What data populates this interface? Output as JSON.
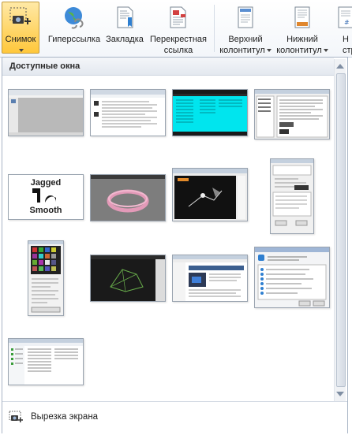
{
  "ribbon": {
    "buttons": [
      {
        "id": "snimok",
        "label": "Снимок",
        "dropdown": true,
        "icon": "screenshot-icon"
      },
      {
        "id": "hyperlink",
        "label": "Гиперссылка",
        "icon": "globe-link-icon"
      },
      {
        "id": "bookmark",
        "label": "Закладка",
        "icon": "bookmark-icon"
      },
      {
        "id": "cross",
        "label_1": "Перекрестная",
        "label_2": "ссылка",
        "icon": "cross-reference-icon"
      },
      {
        "id": "header",
        "label_1": "Верхний",
        "label_2": "колонтитул",
        "dropdown": true,
        "icon": "header-icon"
      },
      {
        "id": "footer",
        "label_1": "Нижний",
        "label_2": "колонтитул",
        "dropdown": true,
        "icon": "footer-icon"
      },
      {
        "id": "pagenum",
        "label_1": "Н",
        "label_2": "стра",
        "icon": "page-number-icon"
      }
    ]
  },
  "panel": {
    "header": "Доступные окна",
    "thumbnails": [
      {
        "name": "window-thumb-1",
        "kind": "gray-app"
      },
      {
        "name": "window-thumb-2",
        "kind": "document"
      },
      {
        "name": "window-thumb-3",
        "kind": "cyan-list"
      },
      {
        "name": "window-thumb-4",
        "kind": "dialog-list"
      },
      {
        "name": "window-thumb-5",
        "kind": "jagged-smooth",
        "text_top": "Jagged",
        "text_bottom": "Smooth"
      },
      {
        "name": "window-thumb-6",
        "kind": "3d-ring"
      },
      {
        "name": "window-thumb-7",
        "kind": "dark-photo"
      },
      {
        "name": "window-thumb-8",
        "kind": "tall-dialog"
      },
      {
        "name": "window-thumb-9",
        "kind": "swatch-grid"
      },
      {
        "name": "window-thumb-10",
        "kind": "dark-3d"
      },
      {
        "name": "window-thumb-11",
        "kind": "web-page"
      },
      {
        "name": "window-thumb-12",
        "kind": "progress-dialog"
      },
      {
        "name": "window-thumb-13",
        "kind": "explorer"
      }
    ],
    "footer": {
      "label": "Вырезка экрана",
      "icon": "screen-clipping-icon"
    }
  },
  "colors": {
    "accent": "#ffd66a",
    "panel_border": "#a9b5c5",
    "cyan": "#00e5ee"
  }
}
